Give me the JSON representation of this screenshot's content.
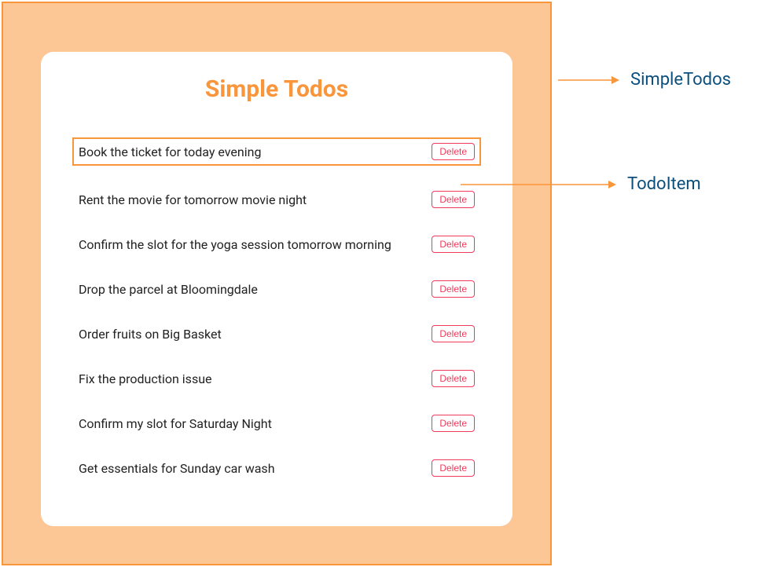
{
  "title": "Simple Todos",
  "delete_label": "Delete",
  "todos": [
    {
      "text": "Book the ticket for today evening",
      "highlighted": true
    },
    {
      "text": "Rent the movie for tomorrow movie night",
      "highlighted": false
    },
    {
      "text": "Confirm the slot for the yoga session tomorrow morning",
      "highlighted": false
    },
    {
      "text": "Drop the parcel at Bloomingdale",
      "highlighted": false
    },
    {
      "text": "Order fruits on Big Basket",
      "highlighted": false
    },
    {
      "text": "Fix the production issue",
      "highlighted": false
    },
    {
      "text": "Confirm my slot for Saturday Night",
      "highlighted": false
    },
    {
      "text": "Get essentials for Sunday car wash",
      "highlighted": false
    }
  ],
  "annotations": {
    "component_label": "SimpleTodos",
    "item_label": "TodoItem"
  }
}
